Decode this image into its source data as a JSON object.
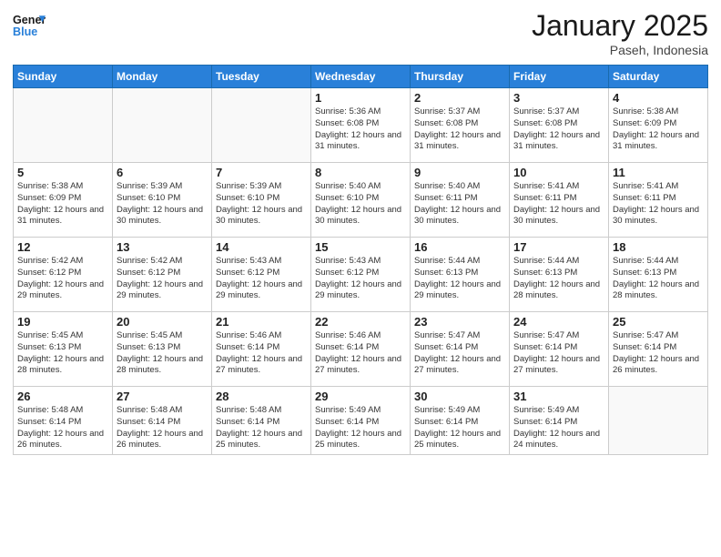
{
  "logo": {
    "line1": "General",
    "line2": "Blue"
  },
  "title": "January 2025",
  "location": "Paseh, Indonesia",
  "days_header": [
    "Sunday",
    "Monday",
    "Tuesday",
    "Wednesday",
    "Thursday",
    "Friday",
    "Saturday"
  ],
  "weeks": [
    [
      {
        "day": "",
        "info": ""
      },
      {
        "day": "",
        "info": ""
      },
      {
        "day": "",
        "info": ""
      },
      {
        "day": "1",
        "info": "Sunrise: 5:36 AM\nSunset: 6:08 PM\nDaylight: 12 hours\nand 31 minutes."
      },
      {
        "day": "2",
        "info": "Sunrise: 5:37 AM\nSunset: 6:08 PM\nDaylight: 12 hours\nand 31 minutes."
      },
      {
        "day": "3",
        "info": "Sunrise: 5:37 AM\nSunset: 6:08 PM\nDaylight: 12 hours\nand 31 minutes."
      },
      {
        "day": "4",
        "info": "Sunrise: 5:38 AM\nSunset: 6:09 PM\nDaylight: 12 hours\nand 31 minutes."
      }
    ],
    [
      {
        "day": "5",
        "info": "Sunrise: 5:38 AM\nSunset: 6:09 PM\nDaylight: 12 hours\nand 31 minutes."
      },
      {
        "day": "6",
        "info": "Sunrise: 5:39 AM\nSunset: 6:10 PM\nDaylight: 12 hours\nand 30 minutes."
      },
      {
        "day": "7",
        "info": "Sunrise: 5:39 AM\nSunset: 6:10 PM\nDaylight: 12 hours\nand 30 minutes."
      },
      {
        "day": "8",
        "info": "Sunrise: 5:40 AM\nSunset: 6:10 PM\nDaylight: 12 hours\nand 30 minutes."
      },
      {
        "day": "9",
        "info": "Sunrise: 5:40 AM\nSunset: 6:11 PM\nDaylight: 12 hours\nand 30 minutes."
      },
      {
        "day": "10",
        "info": "Sunrise: 5:41 AM\nSunset: 6:11 PM\nDaylight: 12 hours\nand 30 minutes."
      },
      {
        "day": "11",
        "info": "Sunrise: 5:41 AM\nSunset: 6:11 PM\nDaylight: 12 hours\nand 30 minutes."
      }
    ],
    [
      {
        "day": "12",
        "info": "Sunrise: 5:42 AM\nSunset: 6:12 PM\nDaylight: 12 hours\nand 29 minutes."
      },
      {
        "day": "13",
        "info": "Sunrise: 5:42 AM\nSunset: 6:12 PM\nDaylight: 12 hours\nand 29 minutes."
      },
      {
        "day": "14",
        "info": "Sunrise: 5:43 AM\nSunset: 6:12 PM\nDaylight: 12 hours\nand 29 minutes."
      },
      {
        "day": "15",
        "info": "Sunrise: 5:43 AM\nSunset: 6:12 PM\nDaylight: 12 hours\nand 29 minutes."
      },
      {
        "day": "16",
        "info": "Sunrise: 5:44 AM\nSunset: 6:13 PM\nDaylight: 12 hours\nand 29 minutes."
      },
      {
        "day": "17",
        "info": "Sunrise: 5:44 AM\nSunset: 6:13 PM\nDaylight: 12 hours\nand 28 minutes."
      },
      {
        "day": "18",
        "info": "Sunrise: 5:44 AM\nSunset: 6:13 PM\nDaylight: 12 hours\nand 28 minutes."
      }
    ],
    [
      {
        "day": "19",
        "info": "Sunrise: 5:45 AM\nSunset: 6:13 PM\nDaylight: 12 hours\nand 28 minutes."
      },
      {
        "day": "20",
        "info": "Sunrise: 5:45 AM\nSunset: 6:13 PM\nDaylight: 12 hours\nand 28 minutes."
      },
      {
        "day": "21",
        "info": "Sunrise: 5:46 AM\nSunset: 6:14 PM\nDaylight: 12 hours\nand 27 minutes."
      },
      {
        "day": "22",
        "info": "Sunrise: 5:46 AM\nSunset: 6:14 PM\nDaylight: 12 hours\nand 27 minutes."
      },
      {
        "day": "23",
        "info": "Sunrise: 5:47 AM\nSunset: 6:14 PM\nDaylight: 12 hours\nand 27 minutes."
      },
      {
        "day": "24",
        "info": "Sunrise: 5:47 AM\nSunset: 6:14 PM\nDaylight: 12 hours\nand 27 minutes."
      },
      {
        "day": "25",
        "info": "Sunrise: 5:47 AM\nSunset: 6:14 PM\nDaylight: 12 hours\nand 26 minutes."
      }
    ],
    [
      {
        "day": "26",
        "info": "Sunrise: 5:48 AM\nSunset: 6:14 PM\nDaylight: 12 hours\nand 26 minutes."
      },
      {
        "day": "27",
        "info": "Sunrise: 5:48 AM\nSunset: 6:14 PM\nDaylight: 12 hours\nand 26 minutes."
      },
      {
        "day": "28",
        "info": "Sunrise: 5:48 AM\nSunset: 6:14 PM\nDaylight: 12 hours\nand 25 minutes."
      },
      {
        "day": "29",
        "info": "Sunrise: 5:49 AM\nSunset: 6:14 PM\nDaylight: 12 hours\nand 25 minutes."
      },
      {
        "day": "30",
        "info": "Sunrise: 5:49 AM\nSunset: 6:14 PM\nDaylight: 12 hours\nand 25 minutes."
      },
      {
        "day": "31",
        "info": "Sunrise: 5:49 AM\nSunset: 6:14 PM\nDaylight: 12 hours\nand 24 minutes."
      },
      {
        "day": "",
        "info": ""
      }
    ]
  ]
}
